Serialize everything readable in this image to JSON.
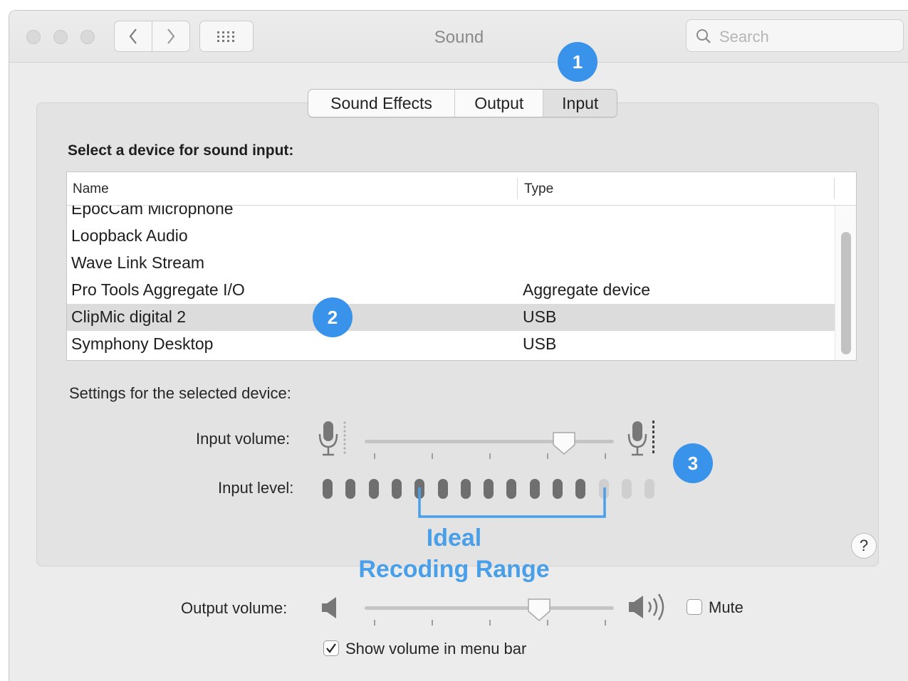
{
  "window": {
    "title": "Sound"
  },
  "search": {
    "placeholder": "Search"
  },
  "tabs": [
    {
      "label": "Sound Effects",
      "selected": false
    },
    {
      "label": "Output",
      "selected": false
    },
    {
      "label": "Input",
      "selected": true
    }
  ],
  "annotations": {
    "badge1": "1",
    "badge2": "2",
    "badge3": "3",
    "ideal_line1": "Ideal",
    "ideal_line2": "Recoding Range",
    "color": "#3a93ea"
  },
  "input": {
    "device_prompt": "Select a device for sound input:",
    "columns": [
      "Name",
      "Type"
    ],
    "devices": [
      {
        "name": "EpocCam Microphone",
        "type": ""
      },
      {
        "name": "Loopback Audio",
        "type": ""
      },
      {
        "name": "Wave Link Stream",
        "type": ""
      },
      {
        "name": "Pro Tools Aggregate I/O",
        "type": "Aggregate device"
      },
      {
        "name": "ClipMic digital 2",
        "type": "USB",
        "selected": true
      },
      {
        "name": "Symphony Desktop",
        "type": "USB"
      }
    ],
    "settings_label": "Settings for the selected device:",
    "volume_label": "Input volume:",
    "volume_value": 0.8,
    "level_label": "Input level:",
    "level_total_bars": 15,
    "level_active_bars": 12
  },
  "output": {
    "volume_label": "Output volume:",
    "volume_value": 0.7,
    "mute_label": "Mute",
    "mute_checked": false,
    "show_in_menu_label": "Show volume in menu bar",
    "show_in_menu_checked": true
  },
  "help": {
    "label": "?"
  }
}
